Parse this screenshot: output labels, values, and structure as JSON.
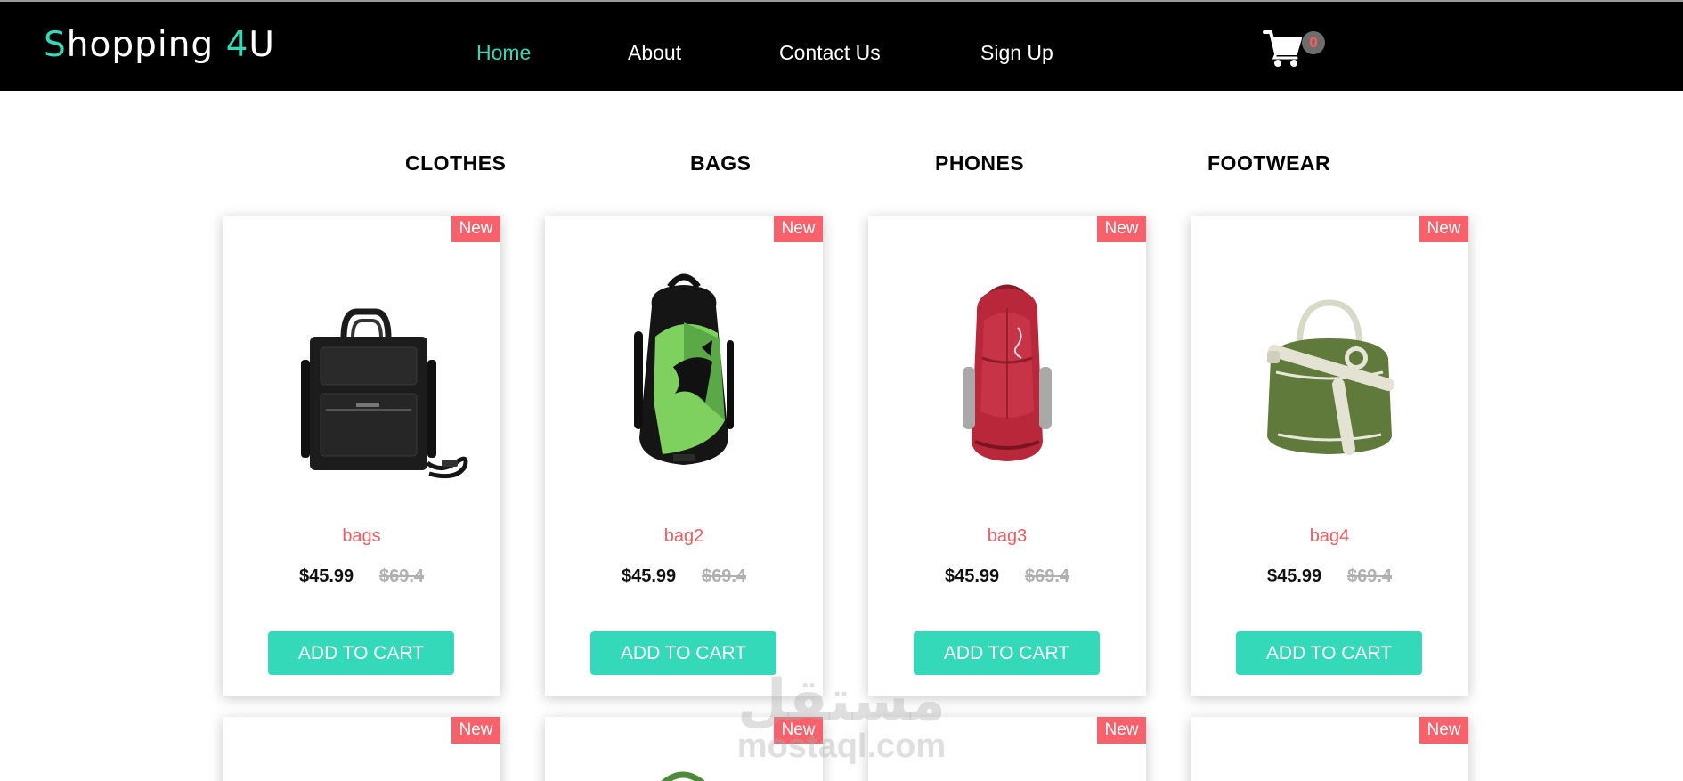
{
  "header": {
    "logo": {
      "s": "S",
      "hopping": "hopping ",
      "four": "4",
      "u": "U"
    },
    "nav": [
      {
        "label": "Home",
        "active": true
      },
      {
        "label": "About",
        "active": false
      },
      {
        "label": "Contact Us",
        "active": false
      },
      {
        "label": "Sign Up",
        "active": false
      }
    ],
    "cart_count": "0"
  },
  "categories": [
    "CLOTHES",
    "BAGS",
    "PHONES",
    "FOOTWEAR"
  ],
  "products": [
    {
      "badge": "New",
      "name": "bags",
      "price": "$45.99",
      "old_price": "$69.4",
      "button": "ADD TO CART"
    },
    {
      "badge": "New",
      "name": "bag2",
      "price": "$45.99",
      "old_price": "$69.4",
      "button": "ADD TO CART"
    },
    {
      "badge": "New",
      "name": "bag3",
      "price": "$45.99",
      "old_price": "$69.4",
      "button": "ADD TO CART"
    },
    {
      "badge": "New",
      "name": "bag4",
      "price": "$45.99",
      "old_price": "$69.4",
      "button": "ADD TO CART"
    }
  ],
  "second_row_badges": [
    "New",
    "New",
    "New",
    "New"
  ],
  "watermark": {
    "arabic": "مستقل",
    "latin": "mostaql.com"
  },
  "colors": {
    "accent": "#34d9b9",
    "badge": "#f6616b",
    "product_name": "#f05b60",
    "header_bg": "#000000"
  }
}
